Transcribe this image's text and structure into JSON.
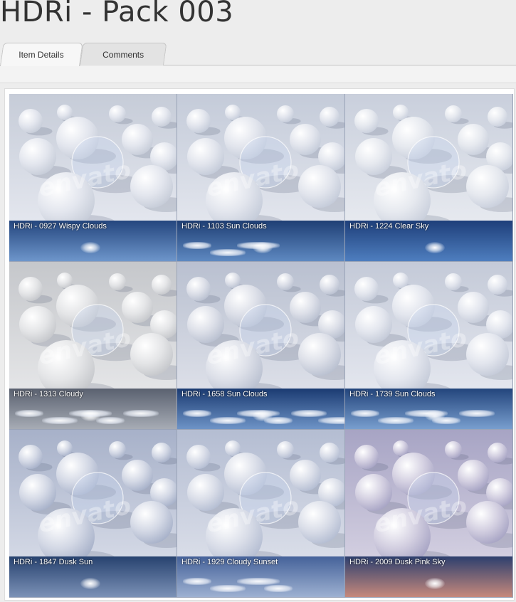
{
  "page": {
    "title": "HDRi - Pack 003"
  },
  "tabs": [
    {
      "label": "Item Details",
      "active": true
    },
    {
      "label": "Comments",
      "active": false
    }
  ],
  "watermark": "envato",
  "colors": {
    "background": "#ededed",
    "tab_active": "#f7f7f7",
    "tab_inactive": "#e3e3e3",
    "label_text": "#ffffff"
  },
  "previews": [
    {
      "label": "HDRi - 0927 Wispy Clouds",
      "scene_top": "#c6ccd8",
      "scene_bottom": "#e3e6ee",
      "sky_top": "#24467e",
      "sky_bottom": "#6f97cc",
      "sun": true,
      "clouds": 0
    },
    {
      "label": "HDRi - 1103 Sun Clouds",
      "scene_top": "#c4cbd9",
      "scene_bottom": "#e2e5ed",
      "sky_top": "#1f3f75",
      "sky_bottom": "#5f8ac2",
      "sun": true,
      "clouds": 3
    },
    {
      "label": "HDRi - 1224 Clear Sky",
      "scene_top": "#c9cfdc",
      "scene_bottom": "#e6e9ef",
      "sky_top": "#1e3f7a",
      "sky_bottom": "#4f7fc0",
      "sun": true,
      "clouds": 0
    },
    {
      "label": "HDRi - 1313 Cloudy",
      "scene_top": "#c5c7cb",
      "scene_bottom": "#e4e5e7",
      "sky_top": "#5a6170",
      "sky_bottom": "#a8adb6",
      "sun": true,
      "clouds": 5
    },
    {
      "label": "HDRi - 1658 Sun Clouds",
      "scene_top": "#b9c0d0",
      "scene_bottom": "#dcdfe8",
      "sky_top": "#1b3b72",
      "sky_bottom": "#6f95c8",
      "sun": true,
      "clouds": 6
    },
    {
      "label": "HDRi - 1739 Sun Clouds",
      "scene_top": "#c4cad8",
      "scene_bottom": "#e3e6ee",
      "sky_top": "#23457c",
      "sky_bottom": "#7aa0d0",
      "sun": true,
      "clouds": 5
    },
    {
      "label": "HDRi - 1847 Dusk Sun",
      "scene_top": "#a7b1c9",
      "scene_bottom": "#d3d8e5",
      "sky_top": "#27426f",
      "sky_bottom": "#7d93b8",
      "sun": true,
      "clouds": 0
    },
    {
      "label": "HDRi - 1929 Cloudy Sunset",
      "scene_top": "#b4bdd2",
      "scene_bottom": "#d9dde8",
      "sky_top": "#45629a",
      "sky_bottom": "#9fb2d2",
      "sun": false,
      "clouds": 4
    },
    {
      "label": "HDRi - 2009 Dusk Pink Sky",
      "scene_top": "#a7a4c4",
      "scene_bottom": "#d2cee0",
      "sky_top": "#2d3f6e",
      "sky_bottom": "#c98a7c",
      "sun": true,
      "clouds": 0
    }
  ]
}
